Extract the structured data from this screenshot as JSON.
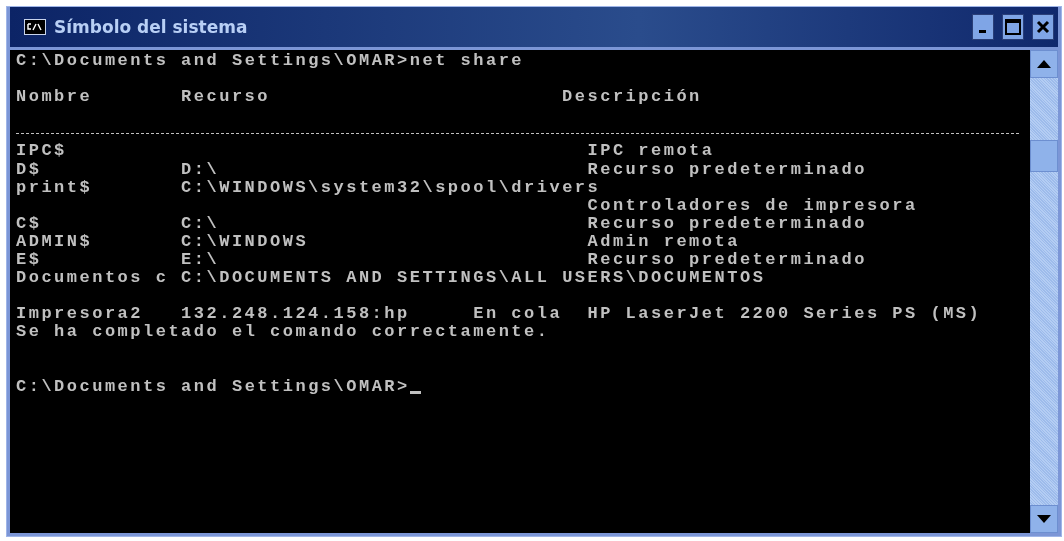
{
  "window": {
    "title": "Símbolo del sistema"
  },
  "console": {
    "command_line": {
      "prompt": "C:\\Documents and Settings\\OMAR>",
      "command": "net share"
    },
    "header": {
      "name": "Nombre",
      "resource": "Recurso",
      "description": "Descripción"
    },
    "rows": [
      {
        "name": "IPC$",
        "description": "IPC remota",
        "blank_after": false
      },
      {
        "name": "D$",
        "resource": "D:\\",
        "description": "Recurso predeterminado",
        "blank_after": false
      },
      {
        "name": "print$",
        "resource": "C:\\WINDOWS\\system32\\spool\\drivers",
        "blank_after": false
      },
      {
        "description": "Controladores de impresora",
        "blank_after": false
      },
      {
        "name": "C$",
        "resource": "C:\\",
        "description": "Recurso predeterminado",
        "blank_after": false
      },
      {
        "name": "ADMIN$",
        "resource": "C:\\WINDOWS",
        "description": "Admin remota",
        "blank_after": false
      },
      {
        "name": "E$",
        "resource": "E:\\",
        "description": "Recurso predeterminado",
        "blank_after": false
      },
      {
        "name": "Documentos c",
        "resource": "C:\\DOCUMENTS AND SETTINGS\\ALL USERS\\DOCUMENTOS",
        "blank_after": true
      },
      {
        "name": "Impresora2",
        "resource": "132.248.124.158:hp",
        "type": "En cola",
        "description": "HP LaserJet 2200 Series PS (MS)",
        "blank_after": false
      }
    ],
    "message": "Se ha completado el comando correctamente.",
    "final_prompt": "C:\\Documents and Settings\\OMAR>",
    "cursor": true
  }
}
